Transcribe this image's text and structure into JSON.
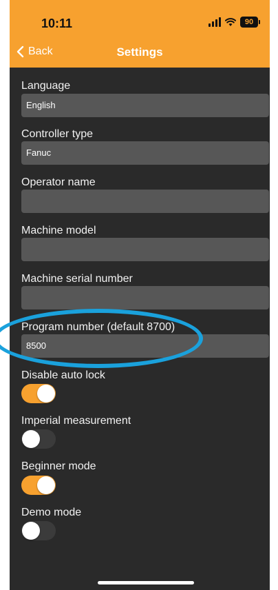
{
  "status_bar": {
    "time": "10:11",
    "battery_level": "90"
  },
  "nav": {
    "back_label": "Back",
    "title": "Settings"
  },
  "fields": {
    "language": {
      "label": "Language",
      "value": "English"
    },
    "controller_type": {
      "label": "Controller type",
      "value": "Fanuc"
    },
    "operator_name": {
      "label": "Operator name",
      "value": ""
    },
    "machine_model": {
      "label": "Machine model",
      "value": ""
    },
    "machine_serial_number": {
      "label": "Machine serial number",
      "value": ""
    },
    "program_number": {
      "label": "Program number (default 8700)",
      "value": "8500"
    }
  },
  "toggles": {
    "disable_auto_lock": {
      "label": "Disable auto lock",
      "on": true
    },
    "imperial_measurement": {
      "label": "Imperial measurement",
      "on": false
    },
    "beginner_mode": {
      "label": "Beginner mode",
      "on": true
    },
    "demo_mode": {
      "label": "Demo mode",
      "on": false
    }
  },
  "colors": {
    "accent": "#f7a12f",
    "background": "#2a2a2a",
    "field": "#575757",
    "annotation": "#1aa1dc"
  }
}
